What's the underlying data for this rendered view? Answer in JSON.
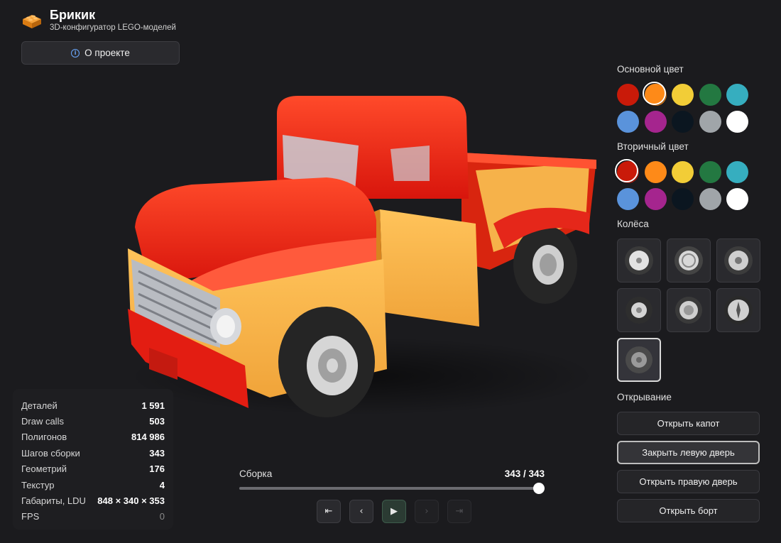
{
  "app": {
    "title": "Брикик",
    "subtitle": "3D-конфигуратор LEGO-моделей",
    "about_label": "О проекте"
  },
  "stats": [
    {
      "label": "Деталей",
      "value": "1 591"
    },
    {
      "label": "Draw calls",
      "value": "503"
    },
    {
      "label": "Полигонов",
      "value": "814 986"
    },
    {
      "label": "Шагов сборки",
      "value": "343"
    },
    {
      "label": "Геометрий",
      "value": "176"
    },
    {
      "label": "Текстур",
      "value": "4"
    },
    {
      "label": "Габариты, LDU",
      "value": "848 × 340 × 353"
    },
    {
      "label": "FPS",
      "value": "0"
    }
  ],
  "assembly": {
    "label": "Сборка",
    "counter": "343 / 343",
    "progress": 1.0
  },
  "controls": [
    {
      "name": "first-step-button",
      "glyph": "⇤",
      "enabled": true
    },
    {
      "name": "prev-step-button",
      "glyph": "‹",
      "enabled": true
    },
    {
      "name": "play-button",
      "glyph": "▶",
      "enabled": true
    },
    {
      "name": "next-step-button",
      "glyph": "›",
      "enabled": false
    },
    {
      "name": "last-step-button",
      "glyph": "⇥",
      "enabled": false
    }
  ],
  "primary_color": {
    "label": "Основной цвет",
    "colors": [
      "#c91a09",
      "#fe8a18",
      "#f2cd37",
      "#237841",
      "#36aebf",
      "#5a93db",
      "#a5258e",
      "#0b1620",
      "#a0a5a9",
      "#ffffff"
    ],
    "selected": 1
  },
  "secondary_color": {
    "label": "Вторичный цвет",
    "colors": [
      "#c91a09",
      "#fe8a18",
      "#f2cd37",
      "#237841",
      "#36aebf",
      "#5a93db",
      "#a5258e",
      "#0b1620",
      "#a0a5a9",
      "#ffffff"
    ],
    "selected": 0
  },
  "wheels": {
    "label": "Колёса",
    "count": 7,
    "selected": 6
  },
  "opening": {
    "label": "Открывание",
    "buttons": [
      {
        "label": "Открыть капот",
        "active": false
      },
      {
        "label": "Закрыть левую дверь",
        "active": true
      },
      {
        "label": "Открыть правую дверь",
        "active": false
      },
      {
        "label": "Открыть борт",
        "active": false
      }
    ]
  }
}
